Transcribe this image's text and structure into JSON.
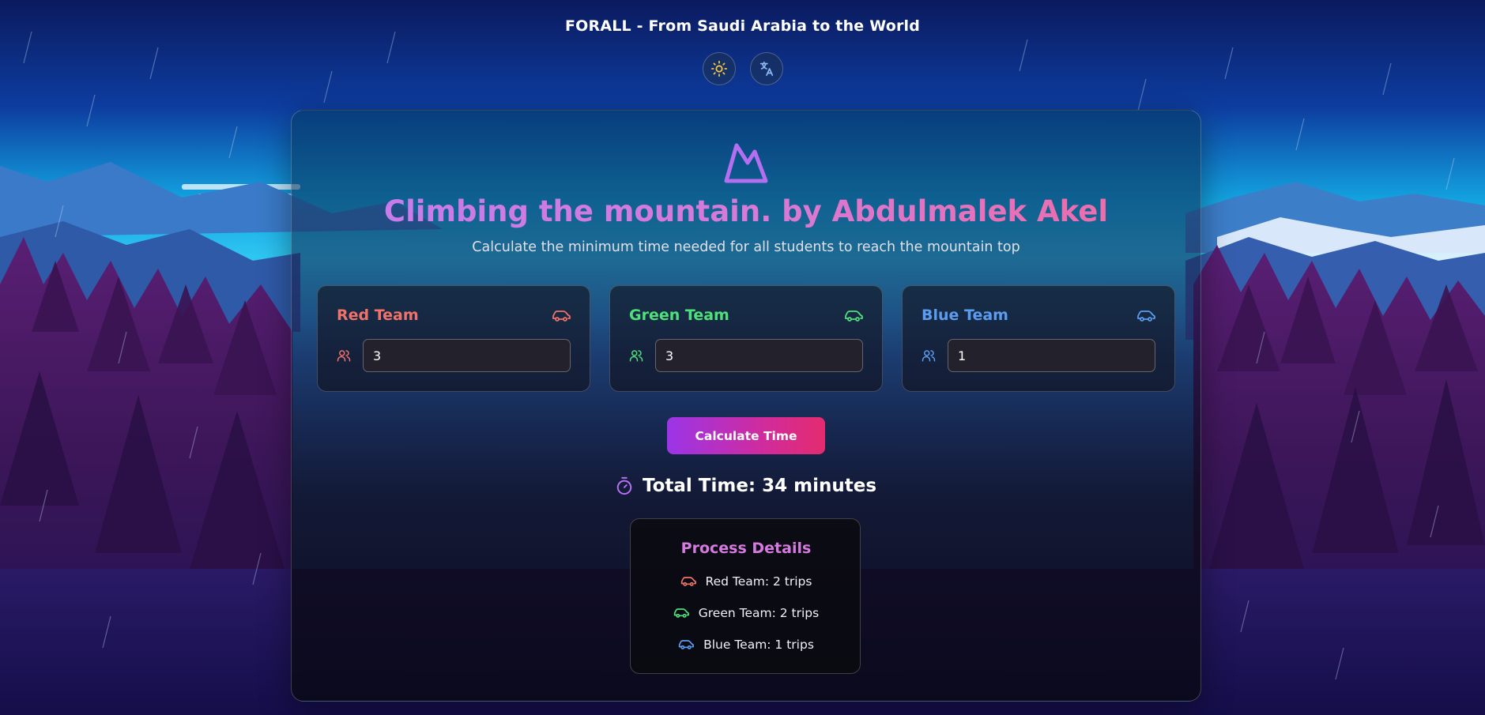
{
  "header": {
    "site_title": "FORALL - From Saudi Arabia to the World",
    "theme_toggle_icon": "sun-icon",
    "language_toggle_icon": "translate-icon"
  },
  "main": {
    "hero_icon": "mountain-icon",
    "title": "Climbing the mountain. by Abdulmalek Akel",
    "subtitle": "Calculate the minimum time needed for all students to reach the mountain top",
    "teams": [
      {
        "name": "Red Team",
        "value": "3",
        "color": "#f0726a",
        "icon": "car-icon"
      },
      {
        "name": "Green Team",
        "value": "3",
        "color": "#4ee07a",
        "icon": "car-icon"
      },
      {
        "name": "Blue Team",
        "value": "1",
        "color": "#5b9cf0",
        "icon": "car-icon"
      }
    ],
    "calculate_label": "Calculate Time",
    "total_icon": "stopwatch-icon",
    "total_text": "Total Time: 34 minutes",
    "details": {
      "title": "Process Details",
      "rows": [
        {
          "text": "Red Team: 2 trips",
          "color": "#f0726a"
        },
        {
          "text": "Green Team: 2 trips",
          "color": "#4ee07a"
        },
        {
          "text": "Blue Team: 1 trips",
          "color": "#5b9cf0"
        }
      ]
    }
  },
  "colors": {
    "accent_purple": "#a855f7",
    "accent_pink": "#e32b6e",
    "title_gradient_start": "#c47cf0",
    "title_gradient_end": "#f26aa0"
  }
}
